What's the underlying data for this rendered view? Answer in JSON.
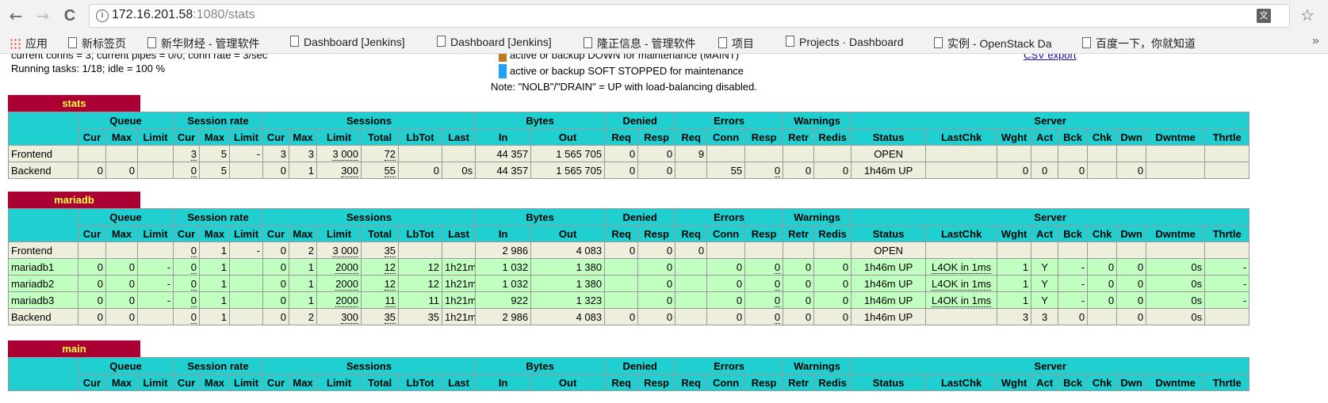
{
  "browser": {
    "url_host": "172.16.201.58",
    "url_rest": ":1080/stats",
    "nav": {
      "back": "←",
      "forward": "→",
      "reload": "C"
    },
    "bookmarks": [
      "应用",
      "新标签页",
      "新华财经 - 管理软件",
      "Dashboard [Jenkins]",
      "Dashboard [Jenkins]",
      "隆正信息 - 管理软件",
      "项目",
      "Projects · Dashboard",
      "实例 - OpenStack Da",
      "百度一下，你就知道"
    ],
    "more": "»"
  },
  "info": {
    "partial_top_left": "current conns = 3; current pipes = 0/0; conn rate = 3/sec",
    "running_tasks": "Running tasks: 1/18; idle = 100 %",
    "legend_partial": "active or backup DOWN for maintenance (MAINT)",
    "legend_soft_stopped": "active or backup SOFT STOPPED for maintenance",
    "note": "Note: \"NOLB\"/\"DRAIN\" = UP with load-balancing disabled.",
    "csv_link": "CSV export",
    "colors": {
      "maint": "#c07820",
      "soft_stopped": "#20a0ff"
    }
  },
  "headers": {
    "groups": [
      "Queue",
      "Session rate",
      "Sessions",
      "Bytes",
      "Denied",
      "Errors",
      "Warnings",
      "Server"
    ],
    "cols": [
      "Cur",
      "Max",
      "Limit",
      "Cur",
      "Max",
      "Limit",
      "Cur",
      "Max",
      "Limit",
      "Total",
      "LbTot",
      "Last",
      "In",
      "Out",
      "Req",
      "Resp",
      "Req",
      "Conn",
      "Resp",
      "Retr",
      "Redis",
      "Status",
      "LastChk",
      "Wght",
      "Act",
      "Bck",
      "Chk",
      "Dwn",
      "Dwntme",
      "Thrtle"
    ]
  },
  "proxies": [
    {
      "name": "stats",
      "rows": [
        {
          "type": "frontend",
          "cells": [
            "Frontend",
            "",
            "",
            "",
            "3",
            "5",
            "-",
            "3",
            "3",
            "3 000",
            "72",
            "",
            "",
            "44 357",
            "1 565 705",
            "0",
            "0",
            "9",
            "",
            "",
            "",
            "",
            "OPEN",
            "",
            "",
            "",
            "",
            "",
            "",
            "",
            ""
          ]
        },
        {
          "type": "backend",
          "cells": [
            "Backend",
            "0",
            "0",
            "",
            "0",
            "5",
            "",
            "0",
            "1",
            "300",
            "55",
            "0",
            "0s",
            "44 357",
            "1 565 705",
            "0",
            "0",
            "",
            "55",
            "0",
            "0",
            "0",
            "1h46m UP",
            "",
            "0",
            "0",
            "0",
            "",
            "0",
            "",
            ""
          ]
        }
      ]
    },
    {
      "name": "mariadb",
      "rows": [
        {
          "type": "frontend",
          "cells": [
            "Frontend",
            "",
            "",
            "",
            "0",
            "1",
            "-",
            "0",
            "2",
            "3 000",
            "35",
            "",
            "",
            "2 986",
            "4 083",
            "0",
            "0",
            "0",
            "",
            "",
            "",
            "",
            "OPEN",
            "",
            "",
            "",
            "",
            "",
            "",
            "",
            ""
          ]
        },
        {
          "type": "server",
          "cells": [
            "mariadb1",
            "0",
            "0",
            "-",
            "0",
            "1",
            "",
            "0",
            "1",
            "2000",
            "12",
            "12",
            "1h21m",
            "1 032",
            "1 380",
            "",
            "0",
            "",
            "0",
            "0",
            "0",
            "0",
            "1h46m UP",
            "L4OK in 1ms",
            "1",
            "Y",
            "-",
            "0",
            "0",
            "0s",
            "-"
          ]
        },
        {
          "type": "server",
          "cells": [
            "mariadb2",
            "0",
            "0",
            "-",
            "0",
            "1",
            "",
            "0",
            "1",
            "2000",
            "12",
            "12",
            "1h21m",
            "1 032",
            "1 380",
            "",
            "0",
            "",
            "0",
            "0",
            "0",
            "0",
            "1h46m UP",
            "L4OK in 1ms",
            "1",
            "Y",
            "-",
            "0",
            "0",
            "0s",
            "-"
          ]
        },
        {
          "type": "server",
          "cells": [
            "mariadb3",
            "0",
            "0",
            "-",
            "0",
            "1",
            "",
            "0",
            "1",
            "2000",
            "11",
            "11",
            "1h21m",
            "922",
            "1 323",
            "",
            "0",
            "",
            "0",
            "0",
            "0",
            "0",
            "1h46m UP",
            "L4OK in 1ms",
            "1",
            "Y",
            "-",
            "0",
            "0",
            "0s",
            "-"
          ]
        },
        {
          "type": "backend",
          "cells": [
            "Backend",
            "0",
            "0",
            "",
            "0",
            "1",
            "",
            "0",
            "2",
            "300",
            "35",
            "35",
            "1h21m",
            "2 986",
            "4 083",
            "0",
            "0",
            "",
            "0",
            "0",
            "0",
            "0",
            "1h46m UP",
            "",
            "3",
            "3",
            "0",
            "",
            "0",
            "0s",
            ""
          ]
        }
      ]
    },
    {
      "name": "main",
      "rows": []
    }
  ]
}
